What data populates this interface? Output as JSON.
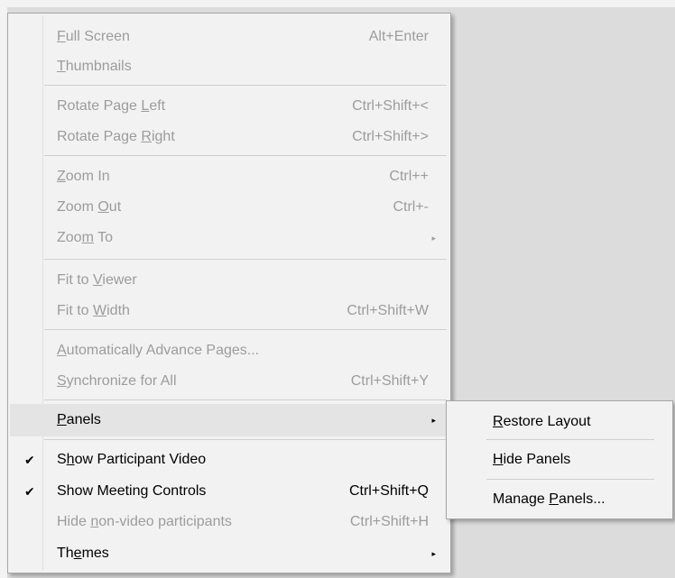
{
  "menu": {
    "items": [
      {
        "pre": "",
        "u": "F",
        "post": "ull Screen",
        "shortcut": "Alt+Enter"
      },
      {
        "pre": "",
        "u": "T",
        "post": "humbnails",
        "shortcut": ""
      },
      {
        "pre": "Rotate Page ",
        "u": "L",
        "post": "eft",
        "shortcut": "Ctrl+Shift+<"
      },
      {
        "pre": "Rotate Page ",
        "u": "R",
        "post": "ight",
        "shortcut": "Ctrl+Shift+>"
      },
      {
        "pre": "",
        "u": "Z",
        "post": "oom In",
        "shortcut": "Ctrl++"
      },
      {
        "pre": "Zoom ",
        "u": "O",
        "post": "ut",
        "shortcut": "Ctrl+-"
      },
      {
        "pre": "Zoo",
        "u": "m",
        "post": " To",
        "shortcut": "",
        "arrow": "▸"
      },
      {
        "pre": "Fit to ",
        "u": "V",
        "post": "iewer",
        "shortcut": ""
      },
      {
        "pre": "Fit to ",
        "u": "W",
        "post": "idth",
        "shortcut": "Ctrl+Shift+W"
      },
      {
        "pre": "",
        "u": "A",
        "post": "utomatically Advance Pages...",
        "shortcut": ""
      },
      {
        "pre": "",
        "u": "S",
        "post": "ynchronize for All",
        "shortcut": "Ctrl+Shift+Y"
      },
      {
        "pre": "",
        "u": "P",
        "post": "anels",
        "shortcut": "",
        "arrow": "▸"
      },
      {
        "pre": "S",
        "u": "h",
        "post": "ow Participant Video",
        "shortcut": "",
        "check": "✔"
      },
      {
        "pre": "Show Meeting Controls",
        "u": "",
        "post": "",
        "shortcut": "Ctrl+Shift+Q",
        "check": "✔"
      },
      {
        "pre": "Hide ",
        "u": "n",
        "post": "on-video participants",
        "shortcut": "Ctrl+Shift+H"
      },
      {
        "pre": "Th",
        "u": "e",
        "post": "mes",
        "shortcut": "",
        "arrow": "▸"
      }
    ]
  },
  "submenu": {
    "items": [
      {
        "pre": "",
        "u": "R",
        "post": "estore Layout"
      },
      {
        "pre": "",
        "u": "H",
        "post": "ide Panels"
      },
      {
        "pre": "Manage ",
        "u": "P",
        "post": "anels..."
      }
    ]
  },
  "colors": {
    "disabled_text": "#9c9c9c",
    "enabled_text": "#000000",
    "highlight": "#e4e4e4"
  }
}
